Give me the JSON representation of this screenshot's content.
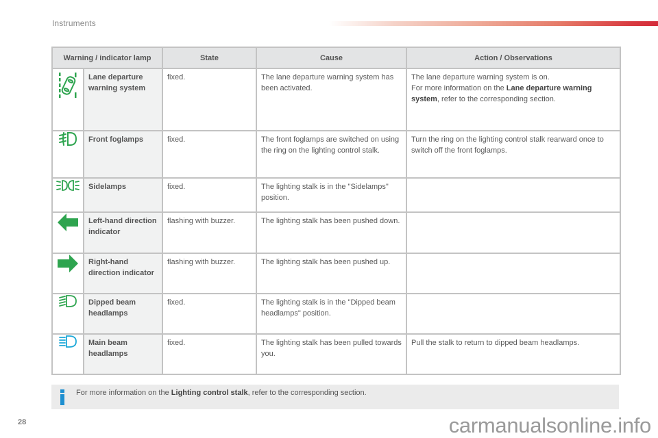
{
  "page": {
    "section_title": "Instruments",
    "page_number": "28",
    "watermark": "carmanualsonline.info",
    "accent_color": "#d42b3a",
    "lamp_green": "#2ea44f",
    "lamp_blue": "#1ba8d8"
  },
  "table": {
    "headers": {
      "lamp": "Warning / indicator lamp",
      "state": "State",
      "cause": "Cause",
      "action": "Action / Observations"
    },
    "rows": [
      {
        "icon": "lane-departure-icon",
        "name": "Lane departure warning system",
        "state": "fixed.",
        "cause": "The lane departure warning system has been activated.",
        "action_pre": "The lane departure warning system is on.\nFor more information on the ",
        "action_bold": "Lane departure warning system",
        "action_post": ", refer to the corresponding section."
      },
      {
        "icon": "front-foglamp-icon",
        "name": "Front foglamps",
        "state": "fixed.",
        "cause": "The front foglamps are switched on using the ring on the lighting control stalk.",
        "action_pre": "Turn the ring on the lighting control stalk rearward once to switch off the front foglamps.",
        "action_bold": "",
        "action_post": ""
      },
      {
        "icon": "sidelamps-icon",
        "name": "Sidelamps",
        "state": "fixed.",
        "cause": "The lighting stalk is in the \"Sidelamps\" position.",
        "action_pre": "",
        "action_bold": "",
        "action_post": ""
      },
      {
        "icon": "left-arrow-icon",
        "name": "Left-hand direction indicator",
        "state": "flashing with buzzer.",
        "cause": "The lighting stalk has been pushed down.",
        "action_pre": "",
        "action_bold": "",
        "action_post": ""
      },
      {
        "icon": "right-arrow-icon",
        "name": "Right-hand direction indicator",
        "state": "flashing with buzzer.",
        "cause": "The lighting stalk has been pushed up.",
        "action_pre": "",
        "action_bold": "",
        "action_post": ""
      },
      {
        "icon": "dipped-beam-icon",
        "name": "Dipped beam headlamps",
        "state": "fixed.",
        "cause": "The lighting stalk is in the \"Dipped beam headlamps\" position.",
        "action_pre": "",
        "action_bold": "",
        "action_post": ""
      },
      {
        "icon": "main-beam-icon",
        "name": "Main beam headlamps",
        "state": "fixed.",
        "cause": "The lighting stalk has been pulled towards you.",
        "action_pre": "Pull the stalk to return to dipped beam headlamps.",
        "action_bold": "",
        "action_post": ""
      }
    ]
  },
  "info_box": {
    "icon": "info-icon",
    "text_pre": "For more information on the ",
    "text_bold": "Lighting control stalk",
    "text_post": ", refer to the corresponding section."
  }
}
